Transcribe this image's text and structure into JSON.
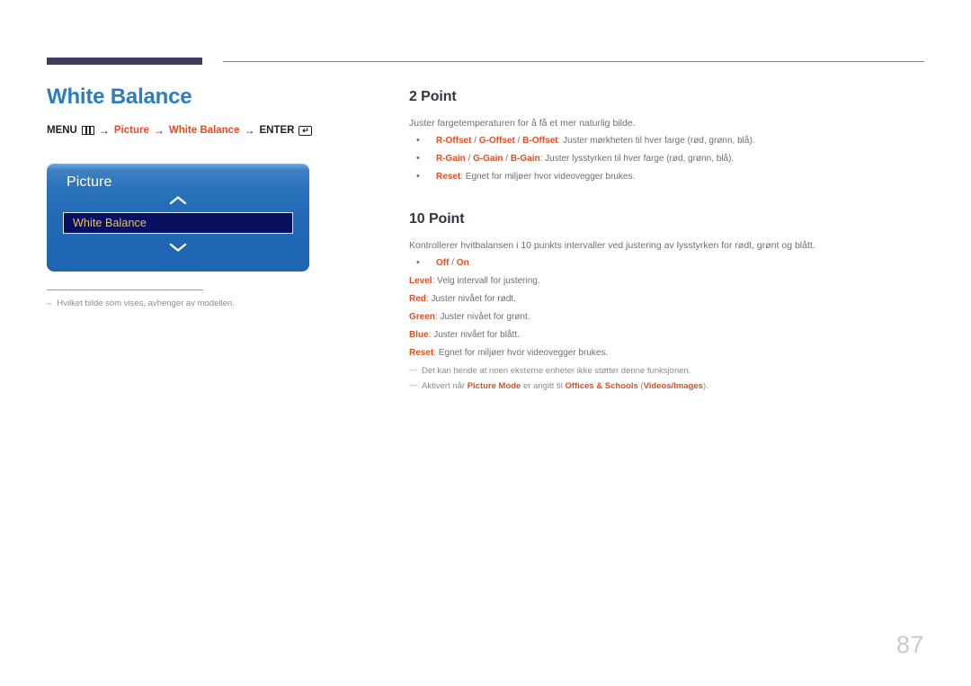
{
  "page": {
    "number": "87"
  },
  "left": {
    "title": "White Balance",
    "breadcrumb": {
      "menu_label": "MENU",
      "menu_icon": "menu-grid-icon",
      "arrow": "→",
      "item1": "Picture",
      "item2": "White Balance",
      "enter_label": "ENTER",
      "enter_icon": "enter-return-icon",
      "enter_glyph": "↵"
    },
    "osd": {
      "title": "Picture",
      "chevron_up": "chevron-up-icon",
      "chevron_down": "chevron-down-icon",
      "selected_item": "White Balance"
    },
    "note": {
      "dash": "–",
      "text": "Hvilket bilde som vises, avhenger av modellen."
    }
  },
  "right": {
    "sections": [
      {
        "heading": "2 Point",
        "intro": "Juster fargetemperaturen for å få et mer naturlig bilde.",
        "bullets": [
          {
            "terms": [
              "R-Offset",
              "G-Offset",
              "B-Offset"
            ],
            "desc": ": Juster mørkheten til hver farge (rød, grønn, blå)."
          },
          {
            "terms": [
              "R-Gain",
              "G-Gain",
              "B-Gain"
            ],
            "desc": ": Juster lysstyrken til hver farge (rød, grønn, blå)."
          },
          {
            "terms": [
              "Reset"
            ],
            "desc": ": Egnet for miljøer hvor videovegger brukes."
          }
        ]
      },
      {
        "heading": "10 Point",
        "intro": "Kontrollerer hvitbalansen i 10 punkts intervaller ved justering av lysstyrken for rødt, grønt og blått.",
        "bullets": [
          {
            "terms": [
              "Off",
              "On"
            ],
            "desc": ""
          }
        ],
        "plain_lines": [
          {
            "term": "Level",
            "desc": ": Velg intervall for justering."
          },
          {
            "term": "Red",
            "desc": ": Juster nivået for rødt."
          },
          {
            "term": "Green",
            "desc": ": Juster nivået for grønt."
          },
          {
            "term": "Blue",
            "desc": ": Juster nivået for blått."
          },
          {
            "term": "Reset",
            "desc": ": Egnet for miljøer hvor videovegger brukes."
          }
        ],
        "footnotes": [
          {
            "parts": [
              {
                "text": "Det kan hende at noen eksterne enheter ikke støtter denne funksjonen.",
                "style": "plain"
              }
            ]
          },
          {
            "parts": [
              {
                "text": "Aktivert når ",
                "style": "plain"
              },
              {
                "text": "Picture Mode",
                "style": "term"
              },
              {
                "text": " er angitt til ",
                "style": "plain"
              },
              {
                "text": "Offices & Schools",
                "style": "term"
              },
              {
                "text": " (",
                "style": "plain"
              },
              {
                "text": "Videos/Images",
                "style": "term"
              },
              {
                "text": ").",
                "style": "plain"
              }
            ]
          }
        ]
      }
    ]
  },
  "colors": {
    "title_blue": "#2e7cc0",
    "accent_orange": "#e04e22",
    "heading_dark": "#3b3142",
    "body_gray": "#6e6e74",
    "rule_navy": "#3f3f5c",
    "osd_blue": "#2068b4",
    "osd_selected_bg": "#0a1060",
    "osd_selected_text": "#e9c45c",
    "page_num_gray": "#c8c8d2"
  }
}
